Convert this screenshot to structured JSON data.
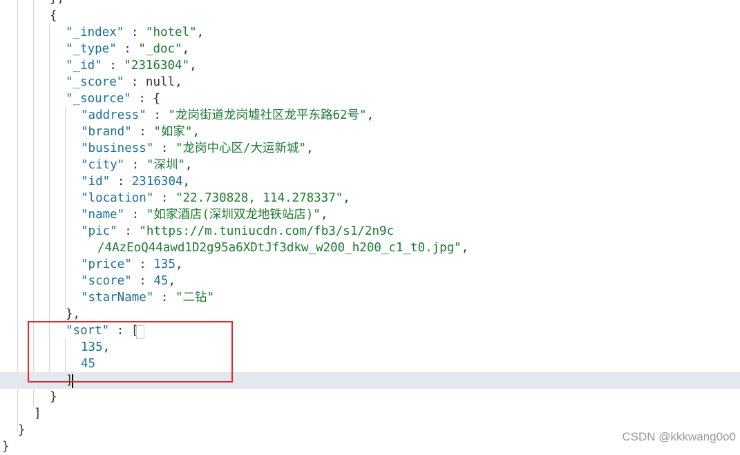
{
  "editor": {
    "lines": [
      "},",
      "{",
      "\"_index\" : \"hotel\",",
      "\"_type\" : \"_doc\",",
      "\"_id\" : \"2316304\",",
      "\"_score\" : null,",
      "\"_source\" : {",
      "\"address\" : \"龙岗街道龙岗墟社区龙平东路62号\",",
      "\"brand\" : \"如家\",",
      "\"business\" : \"龙岗中心区/大运新城\",",
      "\"city\" : \"深圳\",",
      "\"id\" : 2316304,",
      "\"location\" : \"22.730828, 114.278337\",",
      "\"name\" : \"如家酒店(深圳双龙地铁站店)\",",
      "\"pic\" : \"https://m.tuniucdn.com/fb3/s1/2n9c",
      "/4AzEoQ44awd1D2g95a6XDtJf3dkw_w200_h200_c1_t0.jpg\",",
      "\"price\" : 135,",
      "\"score\" : 45,",
      "\"starName\" : \"二钻\"",
      "},",
      "\"sort\" : [",
      "135,",
      "45",
      "]",
      "}",
      "]",
      "}",
      "}"
    ]
  },
  "colors": {
    "key": "#1d6f93",
    "string": "#1a7a30",
    "number": "#1d6f93",
    "highlight_box": "#e5262a",
    "active_line": "#e3e8ef"
  },
  "watermark": "CSDN @kkkwang0o0"
}
